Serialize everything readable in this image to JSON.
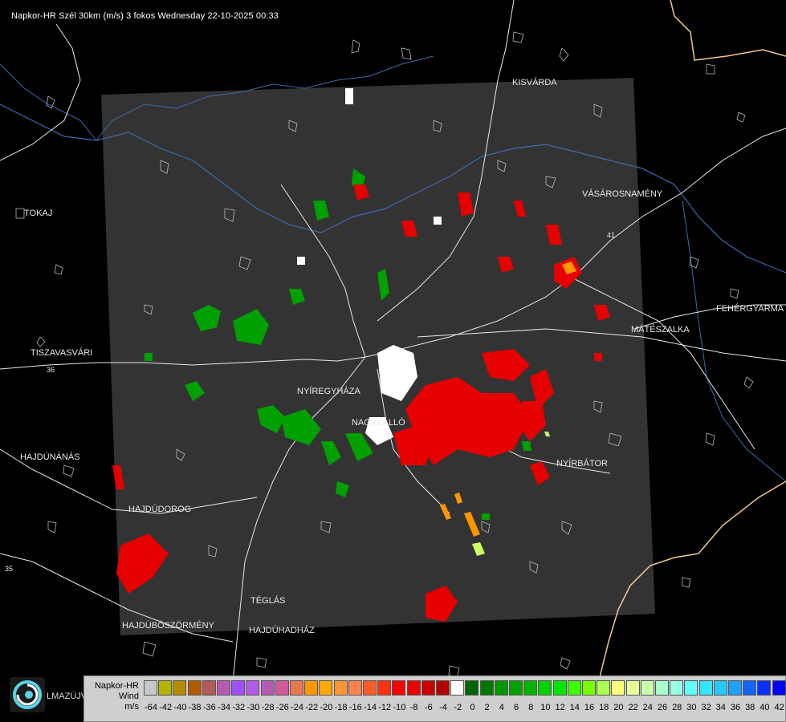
{
  "title": "Napkor-HR Szél 30km (m/s) 3 fokos Wednesday 22-10-2025 00:33",
  "cities": [
    {
      "name": "KISVÁRDA"
    },
    {
      "name": "VÁSÁROSNAMÉNY"
    },
    {
      "name": "TOKAJ"
    },
    {
      "name": "FEHÉRGYARMA"
    },
    {
      "name": "MÁTÉSZALKA"
    },
    {
      "name": "TISZAVASVÁRI"
    },
    {
      "name": "NYÍREGYHÁZA"
    },
    {
      "name": "NAGYKÁLLÓ"
    },
    {
      "name": "NYÍRBÁTOR"
    },
    {
      "name": "HAJDÚNÁNÁS"
    },
    {
      "name": "HAJDÚDOROG"
    },
    {
      "name": "TÉGLÁS"
    },
    {
      "name": "HAJDÚBÖSZÖRMÉNY"
    },
    {
      "name": "HAJDÚHADHÁZ"
    }
  ],
  "road_numbers": [
    "36",
    "41",
    "35"
  ],
  "logo_text": "LMAZÚJVÁR",
  "legend": {
    "title_lines": [
      "Napkor-HR",
      "Wind",
      "m/s"
    ],
    "colors": [
      "#c8c8c8",
      "#b4b400",
      "#b48c00",
      "#b45a00",
      "#b45a5a",
      "#b45ab4",
      "#a050ff",
      "#b45ae6",
      "#b45ab4",
      "#d25a9a",
      "#e67850",
      "#ff9600",
      "#ffaa00",
      "#ff9632",
      "#ff8250",
      "#ff5a28",
      "#ff3214",
      "#ff0000",
      "#e60000",
      "#c80000",
      "#b40000",
      "#ffffff",
      "#006400",
      "#007800",
      "#009600",
      "#00a000",
      "#00b400",
      "#00d200",
      "#00e600",
      "#3cff00",
      "#78ff00",
      "#aaff50",
      "#ffff78",
      "#e6ff96",
      "#c8ffaa",
      "#aaffc8",
      "#96ffe6",
      "#64ffff",
      "#32e6ff",
      "#28c8ff",
      "#1ea0ff",
      "#1464ff",
      "#0a32ff",
      "#0000ff"
    ],
    "labels": [
      "-64",
      "-42",
      "-40",
      "-38",
      "-36",
      "-34",
      "-32",
      "-30",
      "-28",
      "-26",
      "-24",
      "-22",
      "-20",
      "-18",
      "-16",
      "-14",
      "-12",
      "-10",
      "-8",
      "-6",
      "-4",
      "-2",
      "0",
      "2",
      "4",
      "6",
      "8",
      "10",
      "12",
      "14",
      "16",
      "18",
      "20",
      "22",
      "24",
      "26",
      "28",
      "30",
      "32",
      "34",
      "36",
      "38",
      "40",
      "42"
    ]
  }
}
